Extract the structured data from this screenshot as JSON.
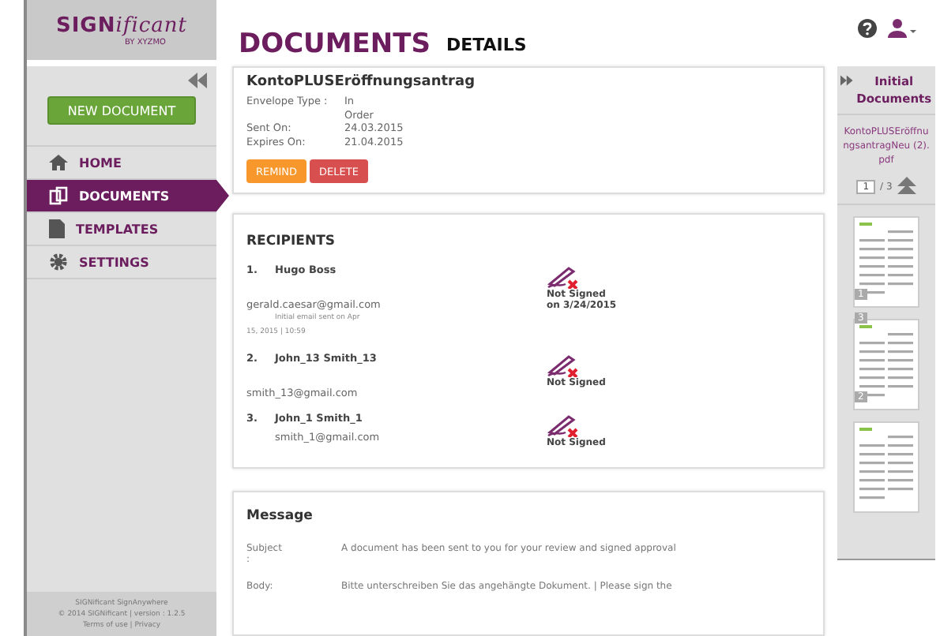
{
  "brand": {
    "name_a": "SIGN",
    "name_b": "ificant",
    "tagline": "BY XYZMO"
  },
  "sidebar": {
    "new_button": "NEW DOCUMENT",
    "items": [
      {
        "label": "HOME",
        "selected": false
      },
      {
        "label": "DOCUMENTS",
        "selected": true
      },
      {
        "label": "TEMPLATES",
        "selected": false
      },
      {
        "label": "SETTINGS",
        "selected": false
      }
    ],
    "footer": [
      "SIGNificant SignAnywhere",
      "© 2014 SIGNificant | version : 1.2.5",
      "Terms of use | Privacy"
    ]
  },
  "header": {
    "title": "DOCUMENTS",
    "subtitle": "DETAILS"
  },
  "document": {
    "name": "KontoPLUSEröffnungsantrag",
    "fields": [
      {
        "label": "Envelope Type :",
        "value": "In\nOrder"
      },
      {
        "label": "Sent On:",
        "value": "24.03.2015"
      },
      {
        "label": "Expires On:",
        "value": "21.04.2015"
      }
    ],
    "buttons": [
      {
        "label": "REMIND",
        "kind": "warning"
      },
      {
        "label": "DELETE",
        "kind": "danger"
      }
    ]
  },
  "recipients": {
    "title": "RECIPIENTS",
    "items": [
      {
        "number": "1.",
        "name": "Hugo Boss",
        "email": "gerald.caesar@gmail.com",
        "note": "Initial email sent on Apr",
        "note2": "15, 2015 | 10:59",
        "status": "Not Signed\non 3/24/2015"
      },
      {
        "number": "2.",
        "name": "John_13 Smith_13",
        "email": "smith_13@gmail.com",
        "status": "Not Signed"
      },
      {
        "number": "3.",
        "name": "John_1 Smith_1",
        "email": "smith_1@gmail.com",
        "status": "Not Signed",
        "inline": true
      }
    ]
  },
  "message": {
    "title": "Message",
    "rows": [
      {
        "label": "Subject\n:",
        "value": "A document has been sent to you for your review and signed approval"
      },
      {
        "label": "Body:",
        "value": "Bitte unterschreiben Sie das angehängte Dokument. | Please sign the"
      }
    ]
  },
  "side_panel": {
    "title": "Initial Documents",
    "file": "KontoPLUSEröffnungsantragNeu (2).pdf",
    "page": "1",
    "pages": "/ 3",
    "thumbnails": [
      {
        "kind": "page",
        "label": "1"
      },
      {
        "kind": "page",
        "label": "2",
        "top_label": "3"
      },
      {
        "kind": "page"
      }
    ]
  }
}
